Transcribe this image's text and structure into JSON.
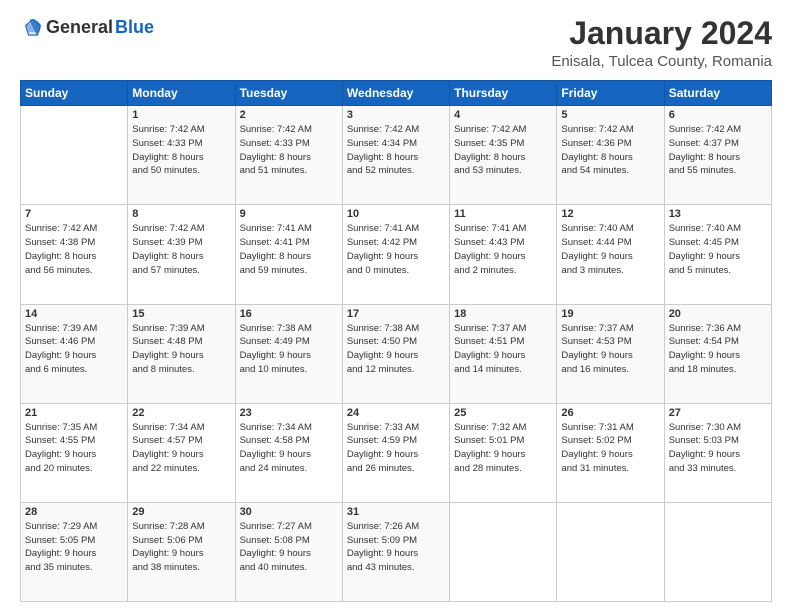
{
  "header": {
    "logo_general": "General",
    "logo_blue": "Blue",
    "title": "January 2024",
    "subtitle": "Enisala, Tulcea County, Romania"
  },
  "weekdays": [
    "Sunday",
    "Monday",
    "Tuesday",
    "Wednesday",
    "Thursday",
    "Friday",
    "Saturday"
  ],
  "weeks": [
    [
      {
        "day": "",
        "info": ""
      },
      {
        "day": "1",
        "info": "Sunrise: 7:42 AM\nSunset: 4:33 PM\nDaylight: 8 hours\nand 50 minutes."
      },
      {
        "day": "2",
        "info": "Sunrise: 7:42 AM\nSunset: 4:33 PM\nDaylight: 8 hours\nand 51 minutes."
      },
      {
        "day": "3",
        "info": "Sunrise: 7:42 AM\nSunset: 4:34 PM\nDaylight: 8 hours\nand 52 minutes."
      },
      {
        "day": "4",
        "info": "Sunrise: 7:42 AM\nSunset: 4:35 PM\nDaylight: 8 hours\nand 53 minutes."
      },
      {
        "day": "5",
        "info": "Sunrise: 7:42 AM\nSunset: 4:36 PM\nDaylight: 8 hours\nand 54 minutes."
      },
      {
        "day": "6",
        "info": "Sunrise: 7:42 AM\nSunset: 4:37 PM\nDaylight: 8 hours\nand 55 minutes."
      }
    ],
    [
      {
        "day": "7",
        "info": "Sunrise: 7:42 AM\nSunset: 4:38 PM\nDaylight: 8 hours\nand 56 minutes."
      },
      {
        "day": "8",
        "info": "Sunrise: 7:42 AM\nSunset: 4:39 PM\nDaylight: 8 hours\nand 57 minutes."
      },
      {
        "day": "9",
        "info": "Sunrise: 7:41 AM\nSunset: 4:41 PM\nDaylight: 8 hours\nand 59 minutes."
      },
      {
        "day": "10",
        "info": "Sunrise: 7:41 AM\nSunset: 4:42 PM\nDaylight: 9 hours\nand 0 minutes."
      },
      {
        "day": "11",
        "info": "Sunrise: 7:41 AM\nSunset: 4:43 PM\nDaylight: 9 hours\nand 2 minutes."
      },
      {
        "day": "12",
        "info": "Sunrise: 7:40 AM\nSunset: 4:44 PM\nDaylight: 9 hours\nand 3 minutes."
      },
      {
        "day": "13",
        "info": "Sunrise: 7:40 AM\nSunset: 4:45 PM\nDaylight: 9 hours\nand 5 minutes."
      }
    ],
    [
      {
        "day": "14",
        "info": "Sunrise: 7:39 AM\nSunset: 4:46 PM\nDaylight: 9 hours\nand 6 minutes."
      },
      {
        "day": "15",
        "info": "Sunrise: 7:39 AM\nSunset: 4:48 PM\nDaylight: 9 hours\nand 8 minutes."
      },
      {
        "day": "16",
        "info": "Sunrise: 7:38 AM\nSunset: 4:49 PM\nDaylight: 9 hours\nand 10 minutes."
      },
      {
        "day": "17",
        "info": "Sunrise: 7:38 AM\nSunset: 4:50 PM\nDaylight: 9 hours\nand 12 minutes."
      },
      {
        "day": "18",
        "info": "Sunrise: 7:37 AM\nSunset: 4:51 PM\nDaylight: 9 hours\nand 14 minutes."
      },
      {
        "day": "19",
        "info": "Sunrise: 7:37 AM\nSunset: 4:53 PM\nDaylight: 9 hours\nand 16 minutes."
      },
      {
        "day": "20",
        "info": "Sunrise: 7:36 AM\nSunset: 4:54 PM\nDaylight: 9 hours\nand 18 minutes."
      }
    ],
    [
      {
        "day": "21",
        "info": "Sunrise: 7:35 AM\nSunset: 4:55 PM\nDaylight: 9 hours\nand 20 minutes."
      },
      {
        "day": "22",
        "info": "Sunrise: 7:34 AM\nSunset: 4:57 PM\nDaylight: 9 hours\nand 22 minutes."
      },
      {
        "day": "23",
        "info": "Sunrise: 7:34 AM\nSunset: 4:58 PM\nDaylight: 9 hours\nand 24 minutes."
      },
      {
        "day": "24",
        "info": "Sunrise: 7:33 AM\nSunset: 4:59 PM\nDaylight: 9 hours\nand 26 minutes."
      },
      {
        "day": "25",
        "info": "Sunrise: 7:32 AM\nSunset: 5:01 PM\nDaylight: 9 hours\nand 28 minutes."
      },
      {
        "day": "26",
        "info": "Sunrise: 7:31 AM\nSunset: 5:02 PM\nDaylight: 9 hours\nand 31 minutes."
      },
      {
        "day": "27",
        "info": "Sunrise: 7:30 AM\nSunset: 5:03 PM\nDaylight: 9 hours\nand 33 minutes."
      }
    ],
    [
      {
        "day": "28",
        "info": "Sunrise: 7:29 AM\nSunset: 5:05 PM\nDaylight: 9 hours\nand 35 minutes."
      },
      {
        "day": "29",
        "info": "Sunrise: 7:28 AM\nSunset: 5:06 PM\nDaylight: 9 hours\nand 38 minutes."
      },
      {
        "day": "30",
        "info": "Sunrise: 7:27 AM\nSunset: 5:08 PM\nDaylight: 9 hours\nand 40 minutes."
      },
      {
        "day": "31",
        "info": "Sunrise: 7:26 AM\nSunset: 5:09 PM\nDaylight: 9 hours\nand 43 minutes."
      },
      {
        "day": "",
        "info": ""
      },
      {
        "day": "",
        "info": ""
      },
      {
        "day": "",
        "info": ""
      }
    ]
  ]
}
